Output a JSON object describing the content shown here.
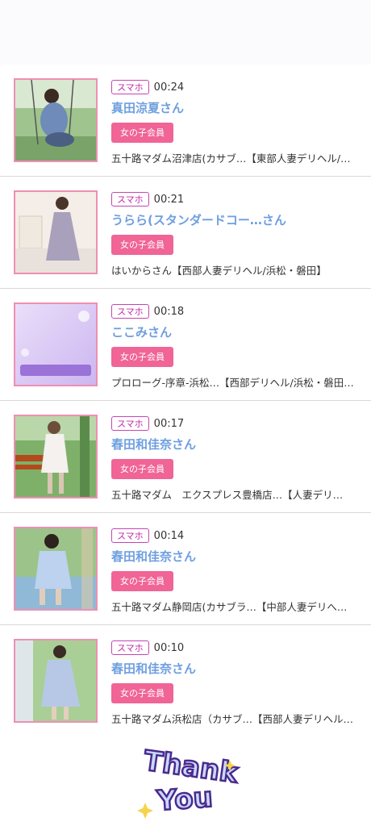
{
  "entries": [
    {
      "device": "スマホ",
      "time": "00:24",
      "name": "真田涼夏さん",
      "badge": "女の子会員",
      "shop": "五十路マダム沼津店(カサブ…【東部人妻デリヘル/…",
      "thumb_text": ""
    },
    {
      "device": "スマホ",
      "time": "00:21",
      "name": "うらら(スタンダードコー…さん",
      "badge": "女の子会員",
      "shop": "はいからさん【西部人妻デリヘル/浜松・磐田】",
      "thumb_text": ""
    },
    {
      "device": "スマホ",
      "time": "00:18",
      "name": "ここみさん",
      "badge": "女の子会員",
      "shop": "プロローグ-序章-浜松…【西部デリヘル/浜松・磐田…",
      "thumb_text": "NO PHOTO 写真準備中 マダムコース"
    },
    {
      "device": "スマホ",
      "time": "00:17",
      "name": "春田和佳奈さん",
      "badge": "女の子会員",
      "shop": "五十路マダム　エクスプレス豊橋店…【人妻デリ…",
      "thumb_text": ""
    },
    {
      "device": "スマホ",
      "time": "00:14",
      "name": "春田和佳奈さん",
      "badge": "女の子会員",
      "shop": "五十路マダム静岡店(カサブラ…【中部人妻デリへ…",
      "thumb_text": ""
    },
    {
      "device": "スマホ",
      "time": "00:10",
      "name": "春田和佳奈さん",
      "badge": "女の子会員",
      "shop": "五十路マダム浜松店（カサブ…【西部人妻デリヘル…",
      "thumb_text": ""
    }
  ],
  "footer": {
    "thanks_line1": "Thank",
    "thanks_line2": "You"
  },
  "colors": {
    "name": "#6e9fe0",
    "badge": "#f06496",
    "device_border": "#c545b2",
    "thumb_border": "#ee8fb4"
  }
}
